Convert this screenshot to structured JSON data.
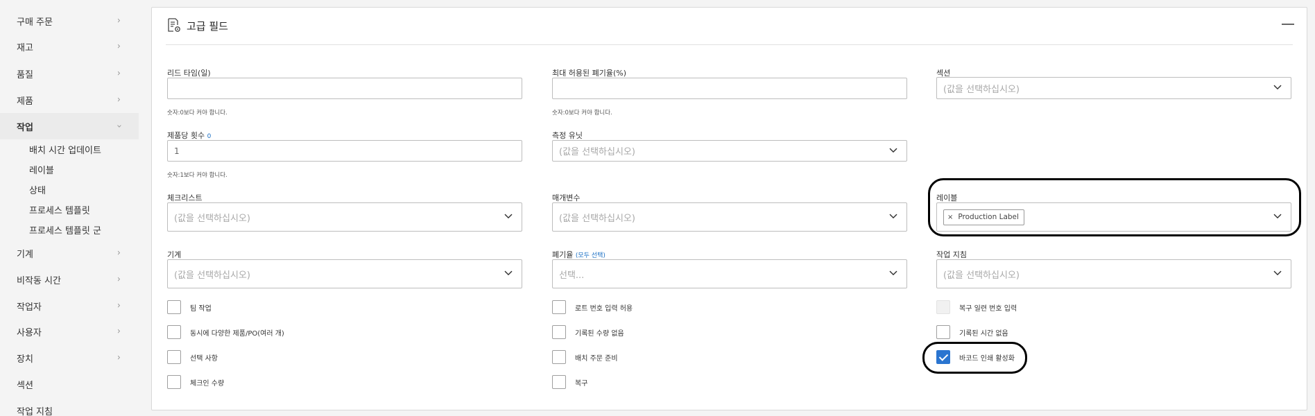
{
  "sidebar": {
    "items": [
      {
        "label": "구매 주문",
        "chevron": "›"
      },
      {
        "label": "재고",
        "chevron": "›"
      },
      {
        "label": "품질",
        "chevron": "›"
      },
      {
        "label": "제품",
        "chevron": "›"
      },
      {
        "label": "작업",
        "chevron": "›"
      },
      {
        "label": "기계",
        "chevron": "›"
      },
      {
        "label": "비작동 시간",
        "chevron": "›"
      },
      {
        "label": "작업자",
        "chevron": "›"
      },
      {
        "label": "사용자",
        "chevron": "›"
      },
      {
        "label": "장치",
        "chevron": "›"
      },
      {
        "label": "섹션",
        "chevron": ""
      },
      {
        "label": "작업 지침",
        "chevron": ""
      }
    ],
    "sub_items": [
      "배치 시간 업데이트",
      "레이블",
      "상태",
      "프로세스 템플릿",
      "프로세스 템플릿 군"
    ]
  },
  "panel": {
    "title": "고급 필드",
    "placeholder_select": "(값을 선택하십시오)",
    "fields": {
      "lead_time": {
        "label": "리드 타임(일)",
        "value": "",
        "hint": "숫자:0보다 커야 합니다."
      },
      "max_scrap": {
        "label": "최대 허용된 폐기율(%)",
        "value": "",
        "hint": "숫자:0보다 커야 합니다."
      },
      "section": {
        "label": "섹션"
      },
      "count_per_product": {
        "label": "제품당 횟수",
        "marker": "0",
        "value": "1",
        "hint": "숫자:1보다 커야 합니다."
      },
      "measure_unit": {
        "label": "측정 유닛"
      },
      "checklist": {
        "label": "체크리스트"
      },
      "parameters": {
        "label": "매개변수"
      },
      "labels": {
        "label": "레이블",
        "chip": "Production Label",
        "chip_remove": "×"
      },
      "machine": {
        "label": "기계"
      },
      "scrap": {
        "label": "폐기율",
        "select_all": "(모두 선택)",
        "placeholder": "선택..."
      },
      "work_instruction": {
        "label": "작업 지침"
      }
    },
    "checkboxes": [
      {
        "label": "팀 작업",
        "checked": false
      },
      {
        "label": "로트 번호 입력 허용",
        "checked": false
      },
      {
        "label": "복구 일련 번호 입력",
        "checked": false,
        "disabled": true
      },
      {
        "label": "동시에 다양한 제품/PO(여러 개)",
        "checked": false
      },
      {
        "label": "기록된 수량 없음",
        "checked": false
      },
      {
        "label": "기록된 시간 없음",
        "checked": false
      },
      {
        "label": "선택 사항",
        "checked": false
      },
      {
        "label": "배치 주문 준비",
        "checked": false
      },
      {
        "label": "바코드 인쇄 활성화",
        "checked": true
      },
      {
        "label": "체크인 수량",
        "checked": false
      },
      {
        "label": "복구",
        "checked": false
      }
    ]
  },
  "colors": {
    "accent": "#2a75d0",
    "link": "#1a6fc4",
    "annotation_ring": "#000000"
  }
}
